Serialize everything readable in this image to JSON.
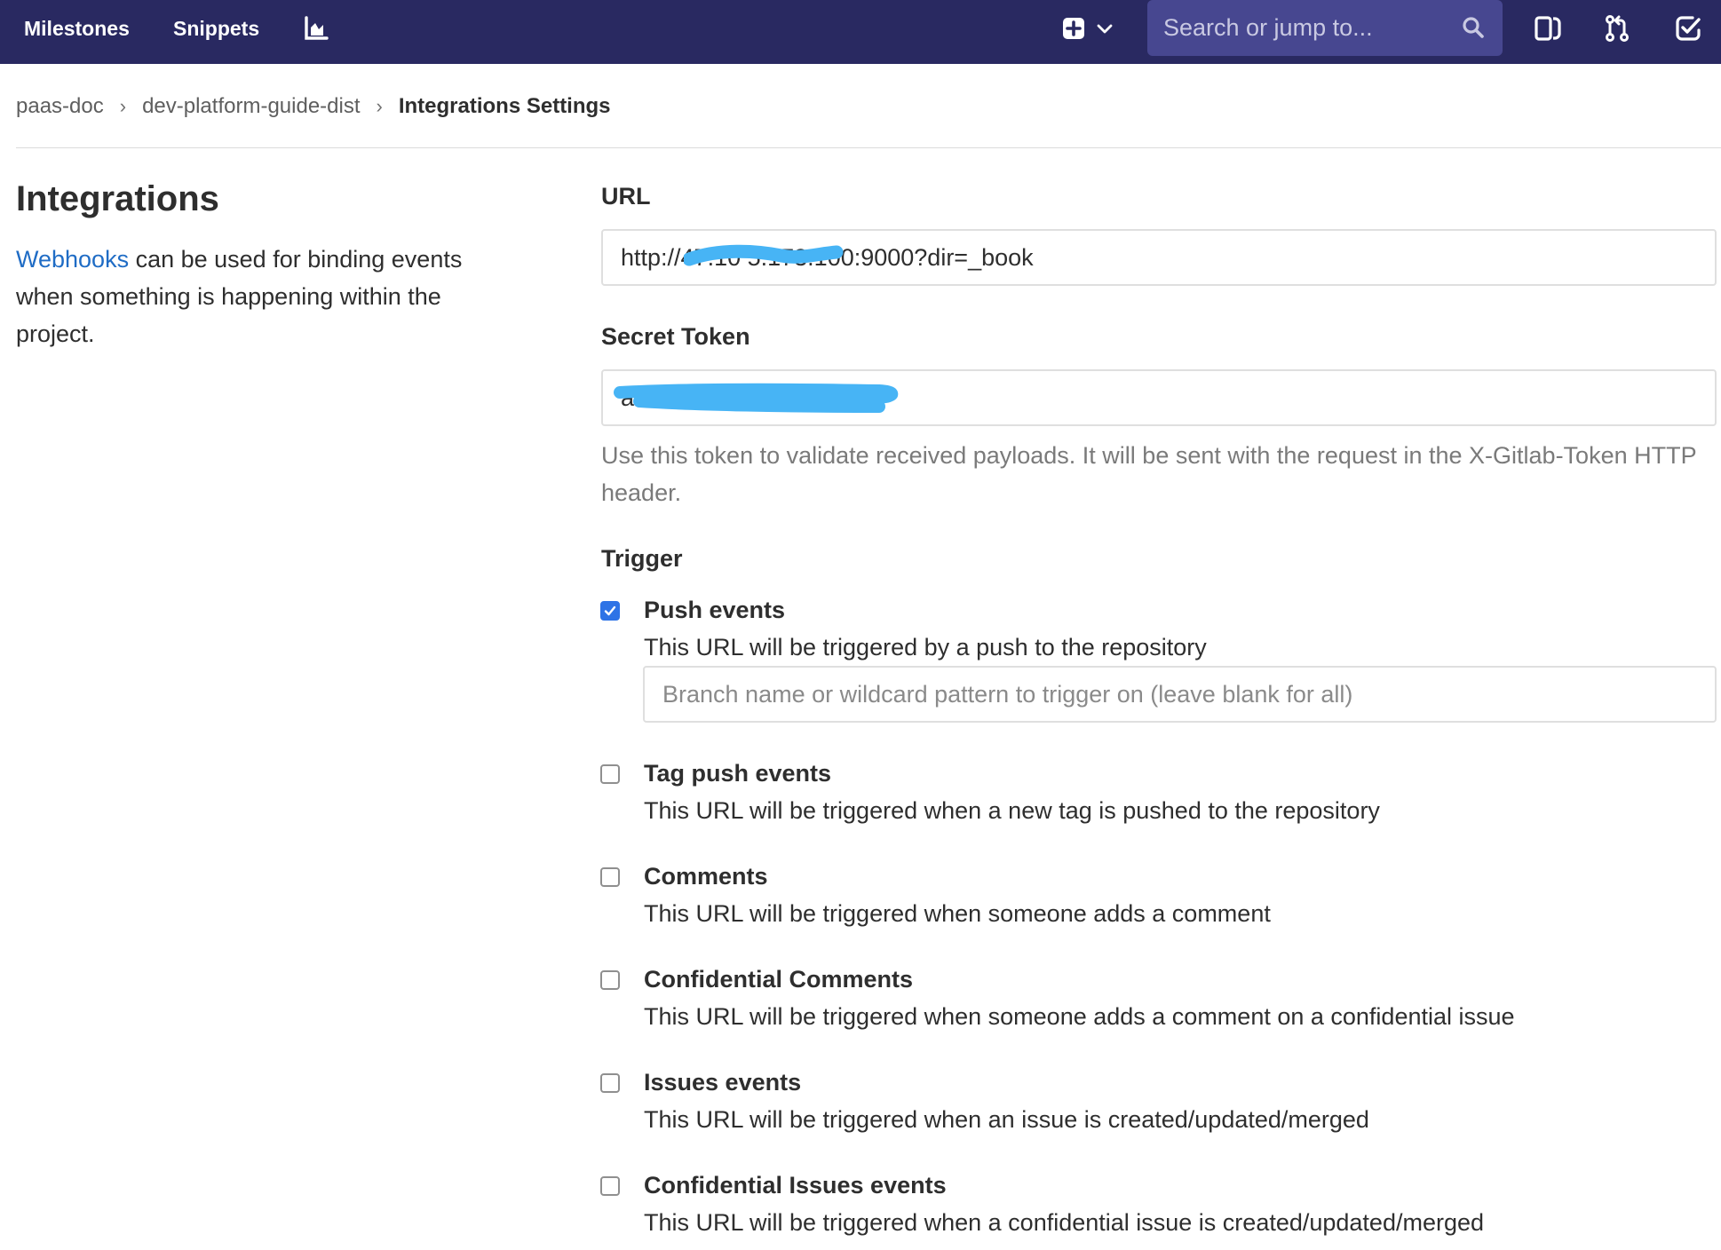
{
  "navbar": {
    "links": [
      "Milestones",
      "Snippets"
    ],
    "search_placeholder": "Search or jump to...",
    "icons": [
      "chart-icon",
      "plus-square-icon",
      "chevron-down-icon",
      "search-icon",
      "sidebar-panel-icon",
      "merge-request-icon",
      "todo-check-icon"
    ],
    "background": "#292961",
    "search_background": "#474790"
  },
  "breadcrumb": {
    "items": [
      "paas-doc",
      "dev-platform-guide-dist"
    ],
    "current": "Integrations Settings",
    "separator": "›"
  },
  "sidebar": {
    "title": "Integrations",
    "link_text": "Webhooks",
    "description": " can be used for binding events when something is happening within the project."
  },
  "form": {
    "url_label": "URL",
    "url_value": "http://47.10 5.173.100:9000?dir=_book",
    "secret_label": "Secret Token",
    "secret_value": "a6e6a1 8d3f 2b7c",
    "secret_help": "Use this token to validate received payloads. It will be sent with the request in the X-Gitlab-Token HTTP header.",
    "trigger_label": "Trigger",
    "branch_placeholder": "Branch name or wildcard pattern to trigger on (leave blank for all)",
    "triggers": [
      {
        "title": "Push events",
        "desc": "This URL will be triggered by a push to the repository",
        "checked": true
      },
      {
        "title": "Tag push events",
        "desc": "This URL will be triggered when a new tag is pushed to the repository",
        "checked": false
      },
      {
        "title": "Comments",
        "desc": "This URL will be triggered when someone adds a comment",
        "checked": false
      },
      {
        "title": "Confidential Comments",
        "desc": "This URL will be triggered when someone adds a comment on a confidential issue",
        "checked": false
      },
      {
        "title": "Issues events",
        "desc": "This URL will be triggered when an issue is created/updated/merged",
        "checked": false
      },
      {
        "title": "Confidential Issues events",
        "desc": "This URL will be triggered when a confidential issue is created/updated/merged",
        "checked": false
      }
    ]
  },
  "colors": {
    "link": "#1f6cc5",
    "checkbox_checked": "#2e73e6",
    "redaction": "#47b4f5"
  }
}
